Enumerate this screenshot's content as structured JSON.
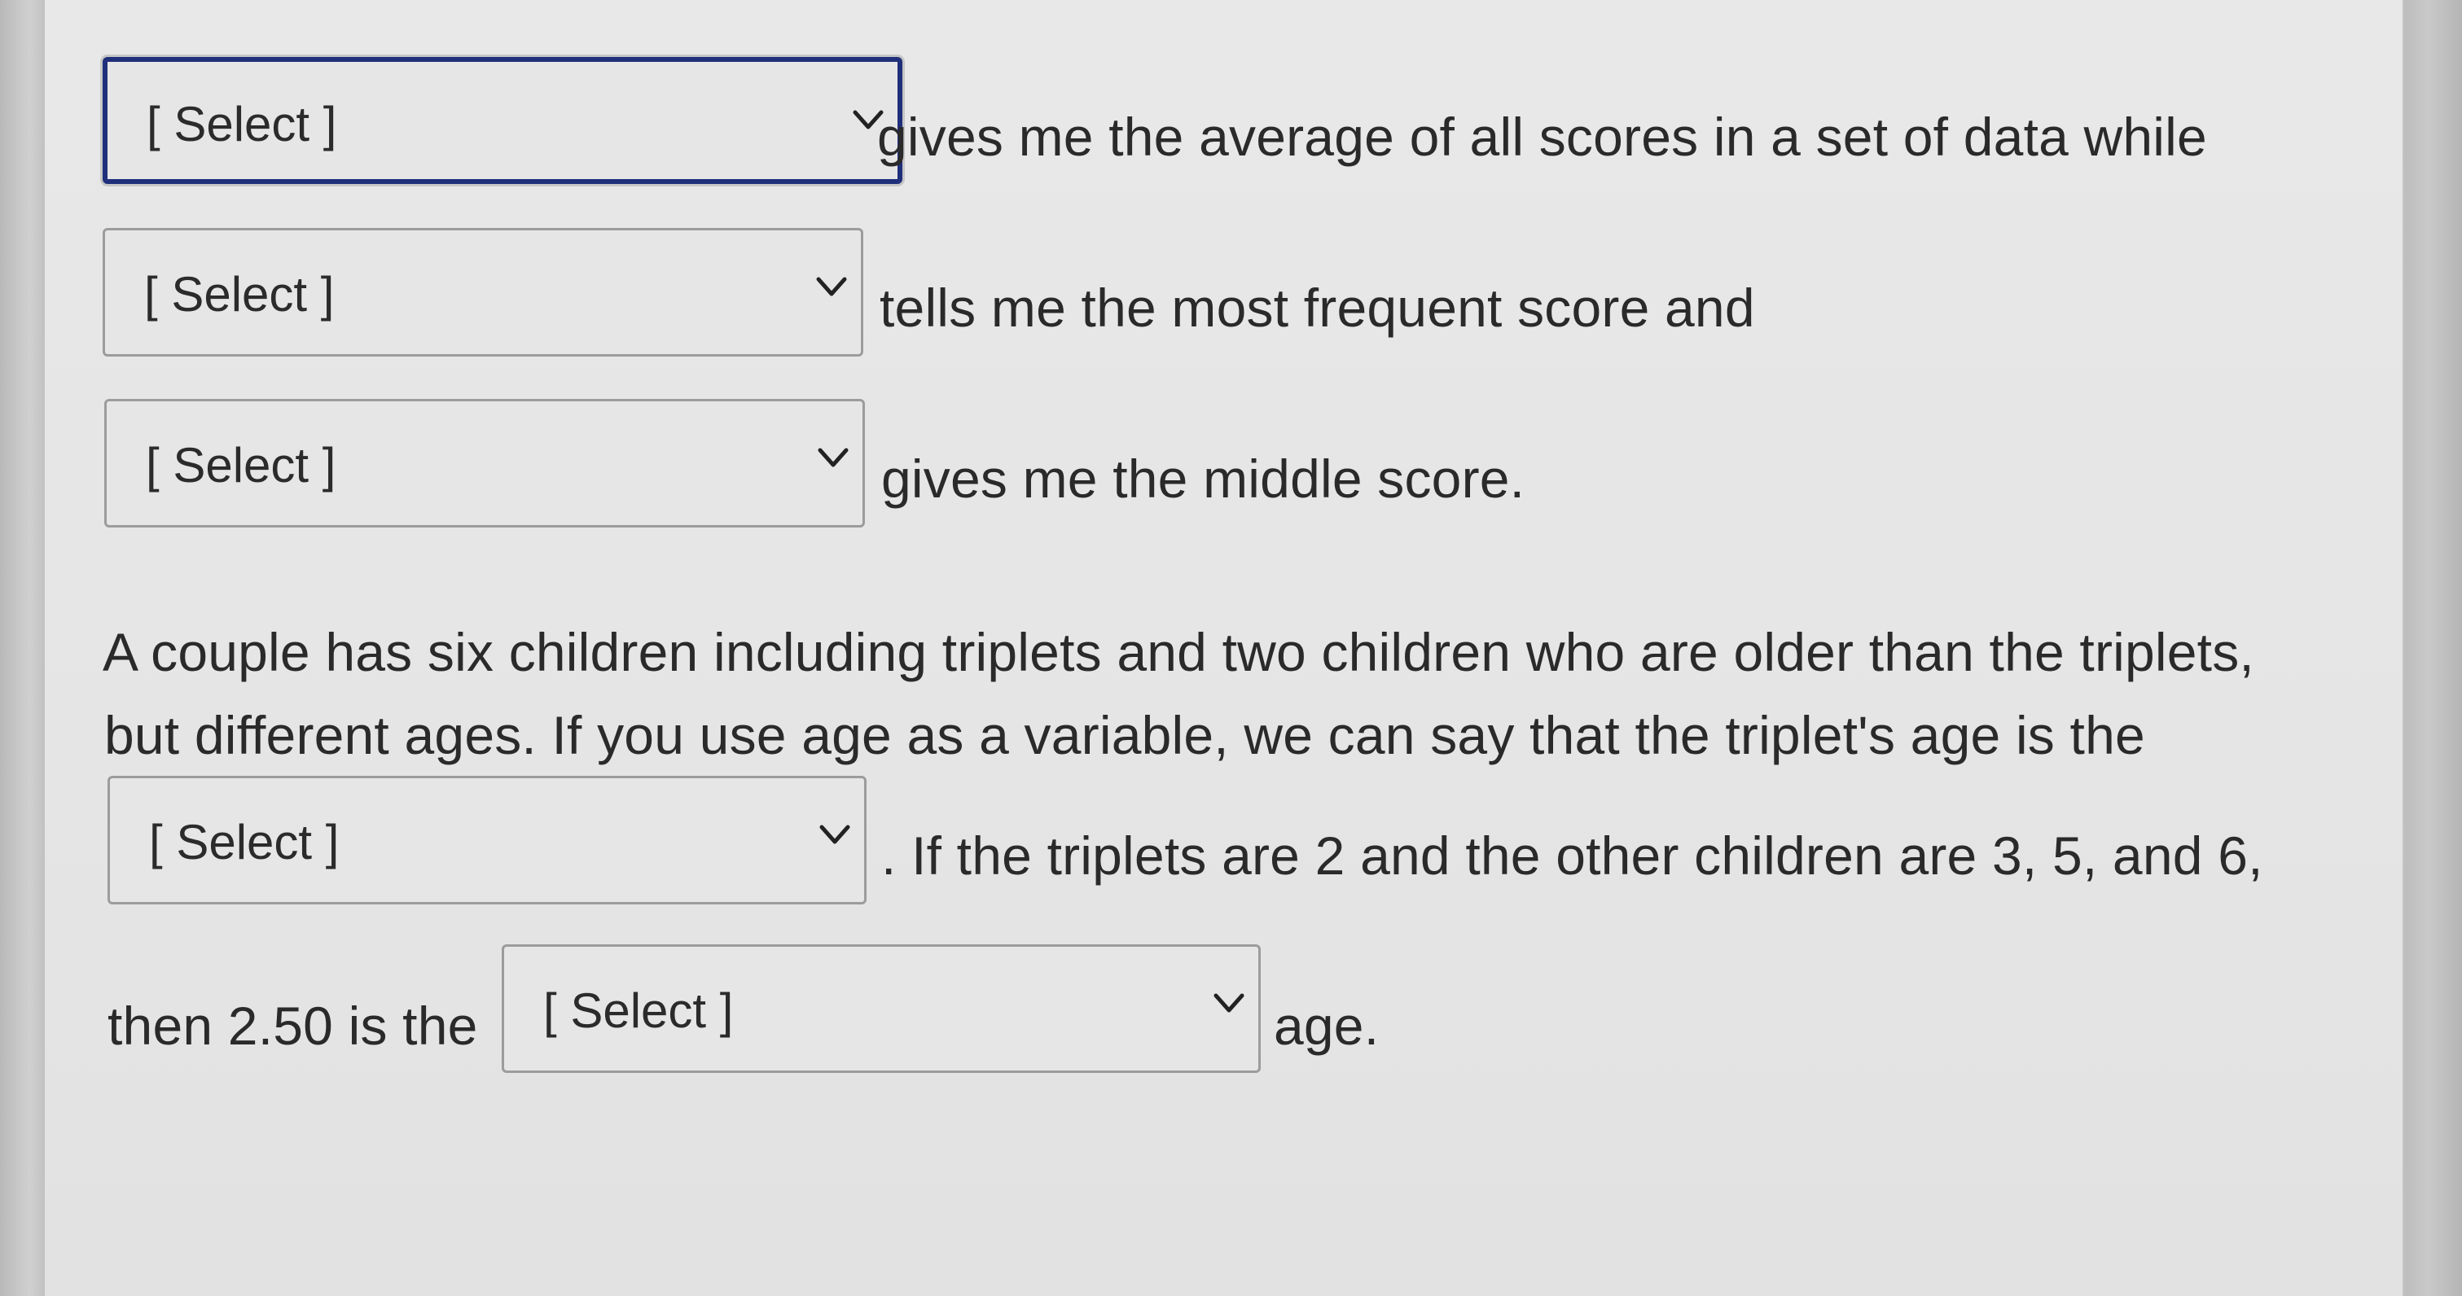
{
  "dropdowns": {
    "placeholder": "[ Select ]"
  },
  "sentences": {
    "s1": "gives me the average of all scores in a set of data while",
    "s2": "tells me the most frequent score and",
    "s3": "gives me the middle score.",
    "p_line1": "A couple has six children including triplets and two children who are older than the triplets,",
    "p_line2": "but different ages. If you use age as a variable, we can say that the triplet's age is the",
    "p_after_select": ". If the triplets are 2 and the other children are 3, 5, and 6,",
    "p_then": "then 2.50 is the",
    "p_end": "age."
  },
  "icons": {
    "dropdown_arrow": "chevron-down-icon"
  }
}
